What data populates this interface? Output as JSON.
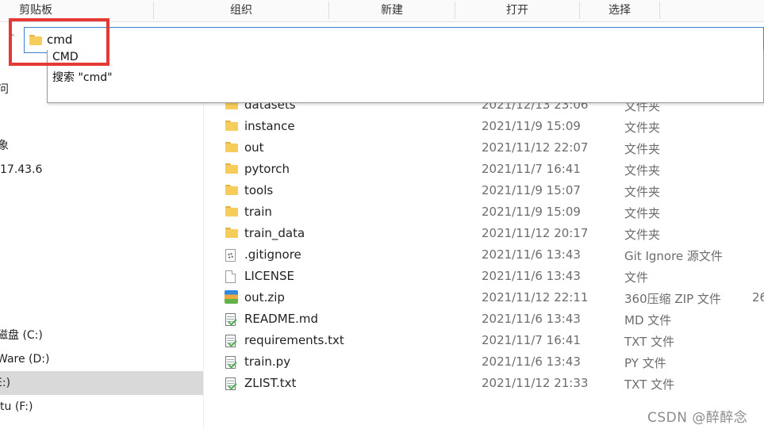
{
  "ribbon": {
    "groups": [
      "剪贴板",
      "组织",
      "新建",
      "打开",
      "选择"
    ]
  },
  "address_bar": {
    "value": "cmd",
    "folder_icon": "folder-icon",
    "up_icon": "up-arrow-icon"
  },
  "autocomplete": {
    "options": [
      "CMD",
      "搜索 \"cmd\""
    ]
  },
  "highlight_color": "#e53935",
  "nav": {
    "items": [
      {
        "label": "问"
      },
      {
        "label": "象"
      },
      {
        "label": "17.43.6"
      },
      {
        "label": "磁盘 (C:)"
      },
      {
        "label": "Ware (D:)"
      },
      {
        "label": "E:)"
      },
      {
        "label": "tu (F:)"
      }
    ]
  },
  "files": [
    {
      "name": "datasets",
      "date": "2021/12/13 23:06",
      "type": "文件夹",
      "size": "",
      "icon": "folder-icon"
    },
    {
      "name": "instance",
      "date": "2021/11/9 15:09",
      "type": "文件夹",
      "size": "",
      "icon": "folder-icon"
    },
    {
      "name": "out",
      "date": "2021/11/12 22:07",
      "type": "文件夹",
      "size": "",
      "icon": "folder-icon"
    },
    {
      "name": "pytorch",
      "date": "2021/11/7 16:41",
      "type": "文件夹",
      "size": "",
      "icon": "folder-icon"
    },
    {
      "name": "tools",
      "date": "2021/11/9 15:07",
      "type": "文件夹",
      "size": "",
      "icon": "folder-icon"
    },
    {
      "name": "train",
      "date": "2021/11/9 15:09",
      "type": "文件夹",
      "size": "",
      "icon": "folder-icon"
    },
    {
      "name": "train_data",
      "date": "2021/11/12 20:17",
      "type": "文件夹",
      "size": "",
      "icon": "folder-icon"
    },
    {
      "name": ".gitignore",
      "date": "2021/11/6 13:43",
      "type": "Git Ignore 源文件",
      "size": "",
      "icon": "config-file-icon"
    },
    {
      "name": "LICENSE",
      "date": "2021/11/6 13:43",
      "type": "文件",
      "size": "",
      "icon": "blank-file-icon"
    },
    {
      "name": "out.zip",
      "date": "2021/11/12 22:11",
      "type": "360压缩 ZIP 文件",
      "size": "26",
      "icon": "zip-archive-icon"
    },
    {
      "name": "README.md",
      "date": "2021/11/6 13:43",
      "type": "MD 文件",
      "size": "",
      "icon": "text-file-icon"
    },
    {
      "name": "requirements.txt",
      "date": "2021/11/7 16:41",
      "type": "TXT 文件",
      "size": "",
      "icon": "text-file-icon"
    },
    {
      "name": "train.py",
      "date": "2021/11/6 13:43",
      "type": "PY 文件",
      "size": "",
      "icon": "text-file-icon"
    },
    {
      "name": "ZLIST.txt",
      "date": "2021/11/12 21:33",
      "type": "TXT 文件",
      "size": "",
      "icon": "text-file-icon"
    }
  ],
  "watermark": "CSDN @醉醉念"
}
